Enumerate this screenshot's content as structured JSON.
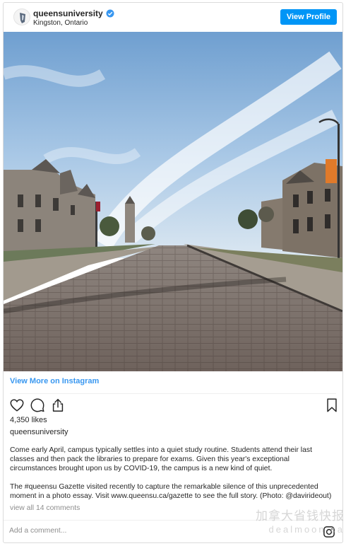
{
  "header": {
    "username": "queensuniversity",
    "location": "Kingston, Ontario",
    "view_profile_label": "View Profile"
  },
  "post": {
    "view_more_label": "View More on Instagram",
    "likes": "4,350 likes",
    "owner": "queensuniversity",
    "caption_p1": "Come early April, campus typically settles into a quiet study routine. Students attend their last classes and then pack the libraries to prepare for exams. Given this year's exceptional circumstances brought upon us by COVID-19, the campus is a new kind of quiet.",
    "caption_p2": "The #queensu Gazette visited recently to capture the remarkable silence of this unprecedented moment in a photo essay. Visit www.queensu.ca/gazette to see the full story. (Photo: @davirideout)",
    "view_comments": "view all 14 comments",
    "add_comment_placeholder": "Add a comment..."
  },
  "watermark": {
    "line1": "加拿大省钱快报",
    "line2": "dealmoon.ca"
  },
  "icons": {
    "verified": "verified-badge-icon",
    "like": "heart-icon",
    "comment": "comment-icon",
    "share": "share-icon",
    "save": "bookmark-icon",
    "instagram": "instagram-icon"
  },
  "colors": {
    "accent": "#0095f6",
    "link": "#3897f0",
    "muted": "#8e8e8e",
    "text": "#262626"
  }
}
